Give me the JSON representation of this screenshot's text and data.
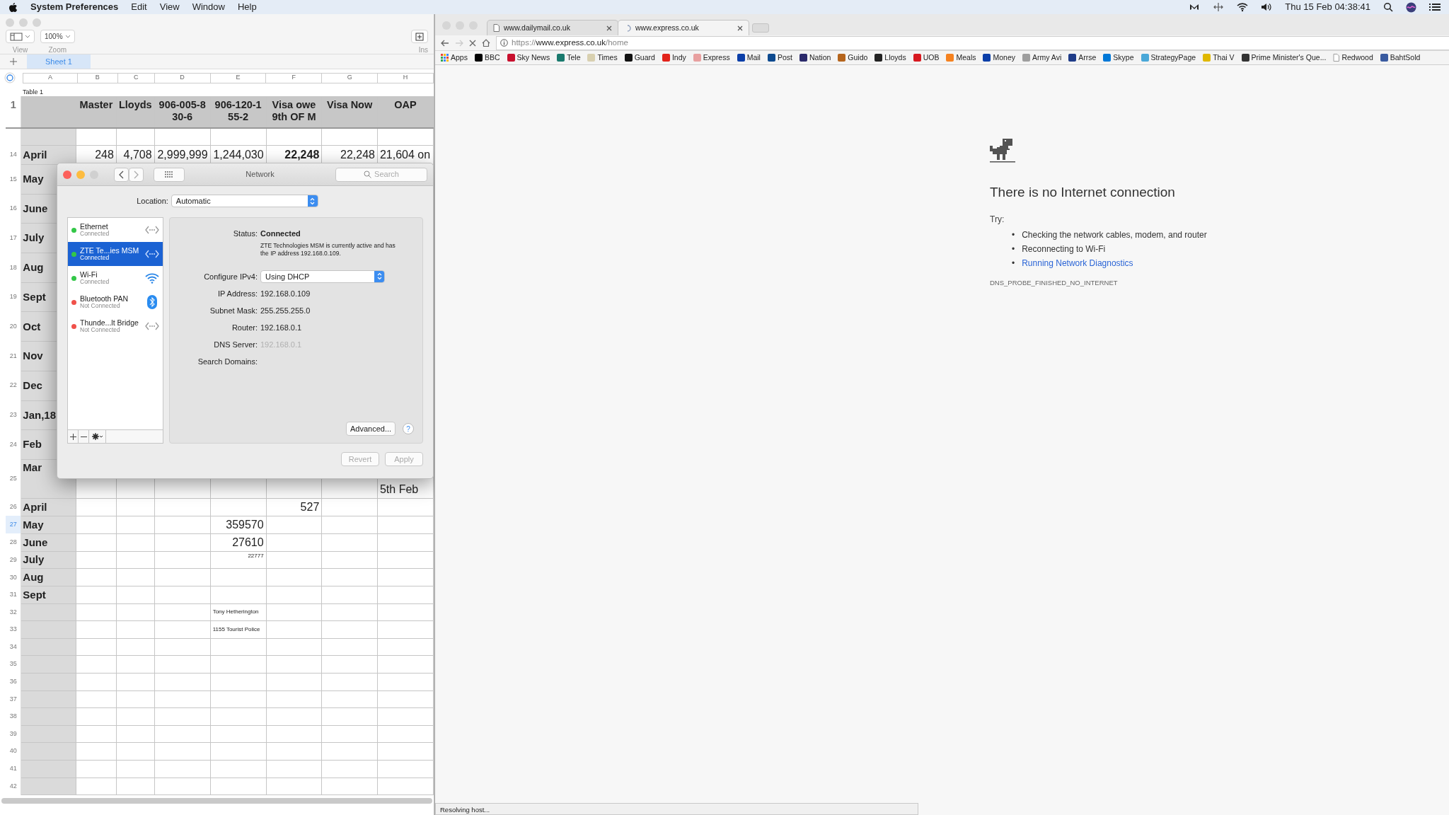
{
  "menubar": {
    "app": "System Preferences",
    "menus": [
      "Edit",
      "View",
      "Window",
      "Help"
    ],
    "clock": "Thu 15 Feb 04:38:41"
  },
  "numbers": {
    "toolbar": [
      {
        "label": "View"
      },
      {
        "label": "Zoom",
        "value": "100%"
      }
    ],
    "insert_label": "Ins",
    "sheets": [
      {
        "label": "Sheet 1",
        "selected": true
      }
    ],
    "columns": [
      "A",
      "B",
      "C",
      "D",
      "E",
      "F",
      "G",
      "H"
    ],
    "table_title": "Table 1",
    "rows": [
      {
        "number": "1",
        "selected": false,
        "cells": [
          null,
          "Master",
          "Lloyds",
          "906-005-8 30-6",
          "906-120-1 55-2",
          "Visa owe 9th OF M",
          "Visa Now",
          "OAP"
        ]
      },
      {},
      {
        "number": "14",
        "selected": false,
        "cells": [
          "April",
          "248",
          "4,708",
          "2,999,999",
          "1,244,030",
          {
            "text": "22,248",
            "kind": "strong"
          },
          "22,248",
          {
            "text": "21,604 on",
            "kind": "label"
          }
        ]
      },
      {
        "number": "15",
        "selected": false,
        "cells": [
          "May"
        ]
      },
      {
        "number": "16",
        "selected": false,
        "cells": [
          "June"
        ]
      },
      {
        "number": "17",
        "selected": false,
        "cells": [
          "July"
        ]
      },
      {
        "number": "18",
        "selected": false,
        "cells": [
          "Aug"
        ]
      },
      {
        "number": "19",
        "selected": false,
        "cells": [
          "Sept"
        ]
      },
      {
        "number": "20",
        "selected": false,
        "cells": [
          "Oct"
        ]
      },
      {
        "number": "21",
        "selected": false,
        "cells": [
          "Nov"
        ]
      },
      {
        "number": "22",
        "selected": false,
        "cells": [
          "Dec"
        ]
      },
      {
        "number": "23",
        "selected": false,
        "cells": [
          "Jan,18"
        ]
      },
      {
        "number": "24",
        "selected": false,
        "cells": [
          "Feb"
        ]
      },
      {
        "number": "25",
        "selected": false,
        "cells": [
          "Mar",
          null,
          null,
          null,
          null,
          null,
          null,
          {
            "text": "5th Feb",
            "kind": "label"
          }
        ]
      },
      {
        "number": "26",
        "selected": false,
        "cells": [
          "April",
          null,
          null,
          null,
          null,
          "527"
        ]
      },
      {
        "number": "27",
        "selected": true,
        "cells": [
          "May",
          null,
          null,
          null,
          "359570"
        ]
      },
      {
        "number": "28",
        "selected": false,
        "cells": [
          "June",
          null,
          null,
          null,
          "27610"
        ]
      },
      {
        "number": "29",
        "selected": false,
        "cells": [
          "July",
          null,
          null,
          null,
          {
            "text": "22777",
            "kind": "tiny"
          }
        ]
      },
      {
        "number": "30",
        "selected": false,
        "cells": [
          "Aug"
        ]
      },
      {
        "number": "31",
        "selected": false,
        "cells": [
          "Sept"
        ]
      },
      {
        "number": "32",
        "selected": false,
        "cells": [
          null,
          null,
          null,
          null,
          {
            "text": "Tony Hetherington",
            "kind": "note"
          }
        ]
      },
      {
        "number": "33",
        "selected": false,
        "cells": [
          null,
          null,
          null,
          null,
          {
            "text": "1155 Tourist Police",
            "kind": "note"
          }
        ]
      },
      {
        "number": "34",
        "selected": false
      },
      {
        "number": "35",
        "selected": false
      },
      {
        "number": "36",
        "selected": false
      },
      {
        "number": "37",
        "selected": false
      },
      {
        "number": "38",
        "selected": false
      },
      {
        "number": "39",
        "selected": false
      },
      {
        "number": "40",
        "selected": false
      },
      {
        "number": "41",
        "selected": false
      },
      {
        "number": "42",
        "selected": false
      }
    ]
  },
  "network": {
    "title": "Network",
    "search_placeholder": "Search",
    "location_label": "Location:",
    "location": "Automatic",
    "services": [
      {
        "name": "Ethernet",
        "status": "Connected",
        "connected": true,
        "selected": false,
        "kind": "ethernet"
      },
      {
        "name": "ZTE Te...ies MSM",
        "status": "Connected",
        "connected": true,
        "selected": true,
        "kind": "ethernet"
      },
      {
        "name": "Wi-Fi",
        "status": "Connected",
        "connected": true,
        "selected": false,
        "kind": "wifi"
      },
      {
        "name": "Bluetooth PAN",
        "status": "Not Connected",
        "connected": false,
        "selected": false,
        "kind": "bluetooth"
      },
      {
        "name": "Thunde...lt Bridge",
        "status": "Not Connected",
        "connected": false,
        "selected": false,
        "kind": "ethernet"
      }
    ],
    "status": {
      "label": "Status:",
      "value": "Connected",
      "note": "ZTE Technologies MSM is currently active and has the IP address 192.168.0.109."
    },
    "configure": {
      "label": "Configure IPv4:",
      "value": "Using DHCP"
    },
    "details": [
      {
        "label": "IP Address:",
        "value": "192.168.0.109"
      },
      {
        "label": "Subnet Mask:",
        "value": "255.255.255.0"
      },
      {
        "label": "Router:",
        "value": "192.168.0.1"
      },
      {
        "label": "DNS Server:",
        "placeholder": "192.168.0.1"
      },
      {
        "label": "Search Domains:"
      }
    ],
    "advanced": "Advanced...",
    "help": "?",
    "buttons": [
      {
        "label": "Revert",
        "disabled": true
      },
      {
        "label": "Apply",
        "disabled": true
      }
    ]
  },
  "browser": {
    "tabs": [
      {
        "title": "www.dailymail.co.uk",
        "selected": false,
        "loading": false
      },
      {
        "title": "www.express.co.uk",
        "selected": true,
        "loading": true
      }
    ],
    "url": {
      "scheme": "https://",
      "host": "www.express.co.uk",
      "path": "/home"
    },
    "bookmarks": [
      {
        "label": "Apps",
        "kind": "apps",
        "color": "#4285f4"
      },
      {
        "label": "BBC",
        "kind": "site",
        "color": "#000000"
      },
      {
        "label": "Sky News",
        "kind": "site",
        "color": "#c8102e"
      },
      {
        "label": "Tele",
        "kind": "site",
        "color": "#1a7a6e"
      },
      {
        "label": "Times",
        "kind": "site",
        "color": "#d8d0b0"
      },
      {
        "label": "Guard",
        "kind": "site",
        "color": "#111111"
      },
      {
        "label": "Indy",
        "kind": "site",
        "color": "#e2231a"
      },
      {
        "label": "Express",
        "kind": "site",
        "color": "#e8a0a0"
      },
      {
        "label": "Mail",
        "kind": "site",
        "color": "#0b3ea8"
      },
      {
        "label": "Post",
        "kind": "site",
        "color": "#0d4a8f"
      },
      {
        "label": "Nation",
        "kind": "site",
        "color": "#2b2a6b"
      },
      {
        "label": "Guido",
        "kind": "site",
        "color": "#b5651d"
      },
      {
        "label": "Lloyds",
        "kind": "site",
        "color": "#222222"
      },
      {
        "label": "UOB",
        "kind": "site",
        "color": "#d71920"
      },
      {
        "label": "Meals",
        "kind": "site",
        "color": "#f58220"
      },
      {
        "label": "Money",
        "kind": "site",
        "color": "#0b3ea8"
      },
      {
        "label": "Army Avi",
        "kind": "site",
        "color": "#9e9e9e"
      },
      {
        "label": "Arrse",
        "kind": "site",
        "color": "#1f3c88"
      },
      {
        "label": "Skype",
        "kind": "site",
        "color": "#0078d7"
      },
      {
        "label": "StrategyPage",
        "kind": "site",
        "color": "#4aa8d8"
      },
      {
        "label": "Thai V",
        "kind": "site",
        "color": "#e0b800"
      },
      {
        "label": "Prime Minister's Que...",
        "kind": "site",
        "color": "#333333"
      },
      {
        "label": "Redwood",
        "kind": "page",
        "color": "#9e9e9e"
      },
      {
        "label": "BahtSold",
        "kind": "site",
        "color": "#3a5ba0"
      }
    ],
    "page": {
      "heading": "There is no Internet connection",
      "try": "Try:",
      "suggestions": [
        {
          "bullet": "•",
          "text": "Checking the network cables, modem, and router",
          "link": false
        },
        {
          "bullet": "•",
          "text": "Reconnecting to Wi-Fi",
          "link": false
        },
        {
          "bullet": "•",
          "text": "Running Network Diagnostics",
          "link": true
        }
      ],
      "code": "DNS_PROBE_FINISHED_NO_INTERNET"
    },
    "status": "Resolving host..."
  }
}
